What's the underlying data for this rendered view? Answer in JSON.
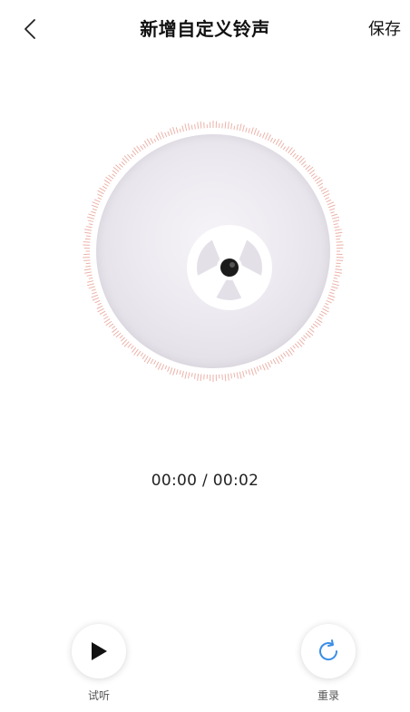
{
  "header": {
    "title": "新增自定义铃声",
    "save_label": "保存",
    "back_icon": "chevron-left-icon"
  },
  "player": {
    "timer": "00:00 / 00:02",
    "play_label": "试听",
    "play_icon": "play-icon",
    "rerecord_label": "重录",
    "rerecord_icon": "refresh-icon"
  },
  "colors": {
    "ring": "#e8a59a",
    "accent_blue": "#3a8ee6",
    "disc": "#ece9f0",
    "text": "#111111"
  }
}
